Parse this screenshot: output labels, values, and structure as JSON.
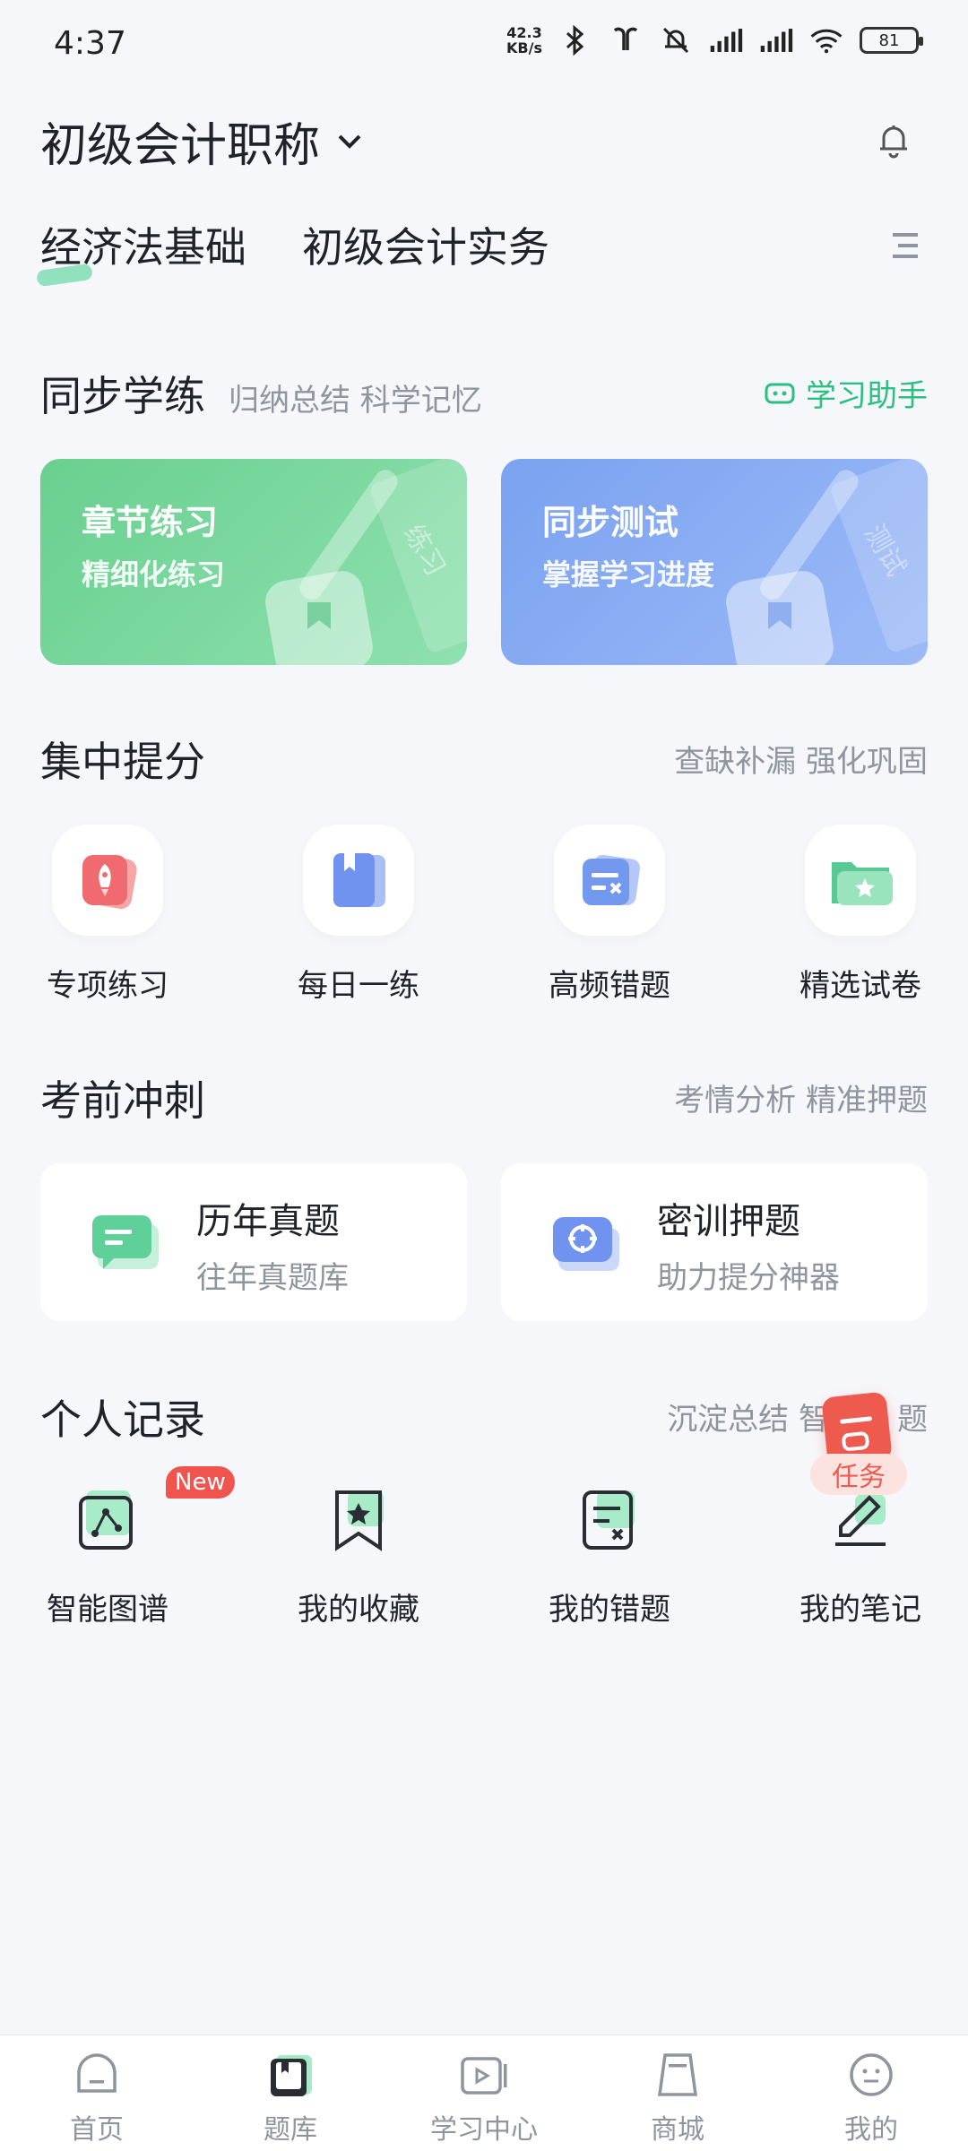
{
  "status_bar": {
    "time": "4:37",
    "net_speed_top": "42.3",
    "net_speed_bottom": "KB/s",
    "battery": "81"
  },
  "header": {
    "exam_name": "初级会计职称"
  },
  "subjects": [
    {
      "label": "经济法基础",
      "active": true
    },
    {
      "label": "初级会计实务",
      "active": false
    }
  ],
  "sync": {
    "title": "同步学练",
    "tagline": "归纳总结  科学记忆",
    "assistant": "学习助手",
    "cards": [
      {
        "title": "章节练习",
        "subtitle": "精细化练习",
        "decor_text": "练习"
      },
      {
        "title": "同步测试",
        "subtitle": "掌握学习进度",
        "decor_text": "测试"
      }
    ]
  },
  "focus": {
    "title": "集中提分",
    "tagline": "查缺补漏 强化巩固",
    "items": [
      {
        "label": "专项练习",
        "icon": "rocket-icon"
      },
      {
        "label": "每日一练",
        "icon": "book-icon"
      },
      {
        "label": "高频错题",
        "icon": "wrong-question-icon"
      },
      {
        "label": "精选试卷",
        "icon": "folder-star-icon"
      }
    ]
  },
  "sprint": {
    "title": "考前冲刺",
    "tagline": "考情分析 精准押题",
    "cards": [
      {
        "title": "历年真题",
        "subtitle": "往年真题库",
        "icon": "chat-icon"
      },
      {
        "title": "密训押题",
        "subtitle": "助力提分神器",
        "icon": "target-icon"
      }
    ]
  },
  "records": {
    "title": "个人记录",
    "tagline": "沉淀总结 智",
    "tagline_tail": "题",
    "new_badge": "New",
    "items": [
      {
        "label": "智能图谱",
        "icon": "graph-icon"
      },
      {
        "label": "我的收藏",
        "icon": "bookmark-star-icon"
      },
      {
        "label": "我的错题",
        "icon": "wrong-note-icon"
      },
      {
        "label": "我的笔记",
        "icon": "pen-icon"
      }
    ]
  },
  "task_float": {
    "label": "任务"
  },
  "bottom_nav": [
    {
      "label": "首页",
      "icon": "home-icon"
    },
    {
      "label": "题库",
      "icon": "question-bank-icon",
      "active": true
    },
    {
      "label": "学习中心",
      "icon": "video-icon"
    },
    {
      "label": "商城",
      "icon": "shop-icon"
    },
    {
      "label": "我的",
      "icon": "profile-icon"
    }
  ],
  "colors": {
    "accent_green": "#2bbf82",
    "card_green": "#69d08f",
    "card_blue": "#7aa2f0",
    "badge_red": "#f0544f"
  }
}
